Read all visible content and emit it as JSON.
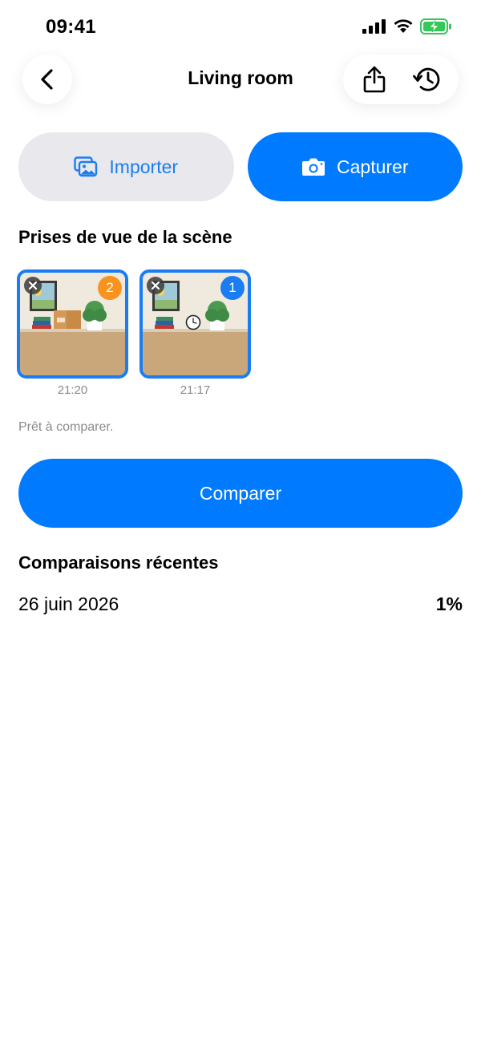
{
  "status_bar": {
    "time": "09:41"
  },
  "nav": {
    "title": "Living room",
    "icons": [
      "chevron-left-icon",
      "share-icon",
      "history-icon"
    ]
  },
  "source": {
    "import_label": "Importer",
    "capture_label": "Capturer"
  },
  "shots": {
    "heading": "Prises de vue de la scène",
    "items": [
      {
        "order": "2",
        "time": "21:20",
        "badge_color": "#f7931e"
      },
      {
        "order": "1",
        "time": "21:17",
        "badge_color": "#1a7df2"
      }
    ]
  },
  "status_text": "Prêt à comparer.",
  "compare_label": "Comparer",
  "recent": {
    "heading": "Comparaisons récentes",
    "items": [
      {
        "date": "26 juin 2026",
        "value": "1%"
      }
    ]
  },
  "colors": {
    "accent": "#007aff",
    "secondary_button_bg": "#e8e8ed"
  }
}
